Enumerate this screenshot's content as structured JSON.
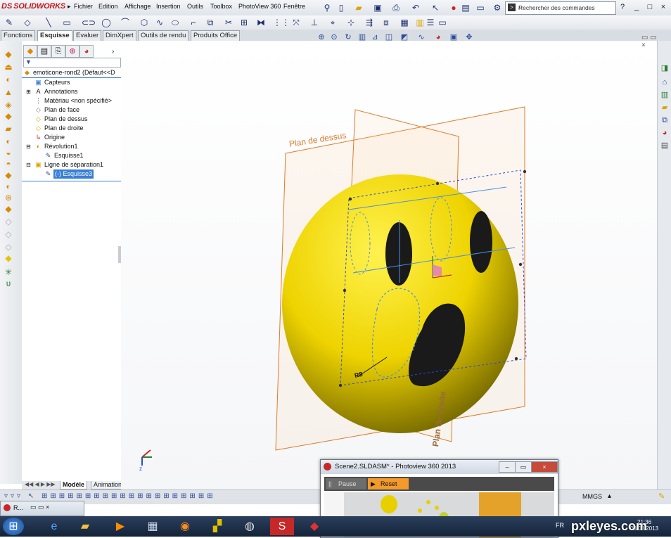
{
  "app": {
    "brand_ds": "DS",
    "brand_name": "SOLIDWORKS"
  },
  "menu": [
    "Fichier",
    "Edition",
    "Affichage",
    "Insertion",
    "Outils",
    "Toolbox",
    "PhotoView 360",
    "Fenêtre"
  ],
  "search": {
    "placeholder": "Rechercher des commandes"
  },
  "window_controls": {
    "help": "?",
    "min": "_",
    "max": "□",
    "close": "×"
  },
  "tabs": [
    "Fonctions",
    "Esquisse",
    "Evaluer",
    "DimXpert",
    "Outils de rendu",
    "Produits Office"
  ],
  "active_tab": "Esquisse",
  "feature_tree": {
    "root": "emoticone-rond2  (Défaut<<D",
    "items": [
      {
        "label": "Capteurs",
        "indent": 1
      },
      {
        "label": "Annotations",
        "indent": 1
      },
      {
        "label": "Matériau <non spécifié>",
        "indent": 1
      },
      {
        "label": "Plan de face",
        "indent": 1
      },
      {
        "label": "Plan de dessus",
        "indent": 1
      },
      {
        "label": "Plan de droite",
        "indent": 1
      },
      {
        "label": "Origine",
        "indent": 1
      },
      {
        "label": "Révolution1",
        "indent": 1
      },
      {
        "label": "Esquisse1",
        "indent": 2
      },
      {
        "label": "Ligne de séparation1",
        "indent": 1
      },
      {
        "label": "(-) Esquisse3",
        "indent": 2,
        "selected": true
      }
    ]
  },
  "bottom_tabs": [
    "Modèle",
    "Animation1"
  ],
  "viewport": {
    "plane_top_label": "Plan de dessus",
    "plane_right_label": "Plan de droite",
    "dimension_label": "R8",
    "axis_label": "z"
  },
  "status": {
    "units": "MMGS"
  },
  "photoview": {
    "title": "Scene2.SLDASM* - Photoview 360 2013",
    "pause_label": "Pause",
    "reset_label": "Reset"
  },
  "mini_window": {
    "label": "R..."
  },
  "taskbar": {
    "lang": "FR",
    "time": "21:36",
    "date": "03/08/2013"
  },
  "watermark": "pxleyes.com",
  "colors": {
    "plane": "#e07b2a",
    "face": "#f1e000",
    "sketch": "#4a90e2",
    "accent": "#3a7fd6"
  }
}
